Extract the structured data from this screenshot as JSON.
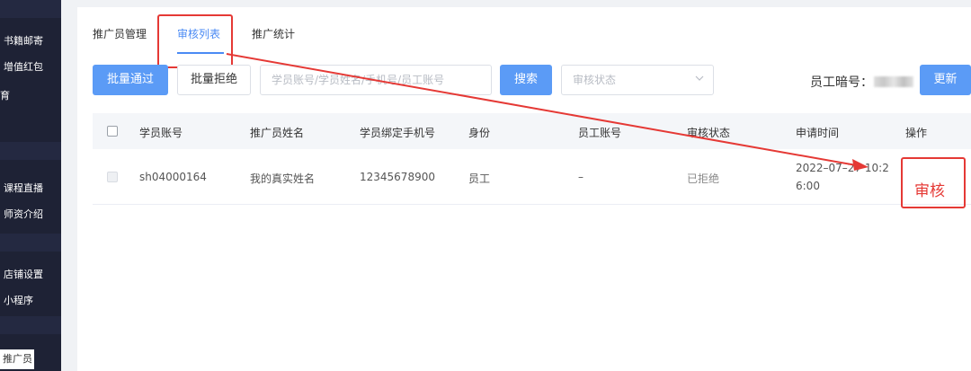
{
  "sidebar": {
    "items": [
      {
        "label": "书籍邮寄"
      },
      {
        "label": "增值红包"
      },
      {
        "label": "育"
      },
      {
        "label": "课程直播"
      },
      {
        "label": "师资介绍"
      },
      {
        "label": "店铺设置"
      },
      {
        "label": "小程序"
      }
    ],
    "active_label": "推广员"
  },
  "tabs": [
    {
      "label": "推广员管理"
    },
    {
      "label": "审核列表"
    },
    {
      "label": "推广统计"
    }
  ],
  "toolbar": {
    "approve_label": "批量通过",
    "reject_label": "批量拒绝",
    "search_placeholder": "学员账号/学员姓名/手机号/员工账号",
    "search_label": "搜索",
    "status_placeholder": "审核状态",
    "employee_code_label": "员工暗号：",
    "update_label": "更新"
  },
  "table": {
    "headers": [
      "学员账号",
      "推广员姓名",
      "学员绑定手机号",
      "身份",
      "员工账号",
      "审核状态",
      "申请时间",
      "操作"
    ],
    "rows": [
      {
        "student_account": "sh04000164",
        "promoter_name": "我的真实姓名",
        "phone": "12345678900",
        "identity": "员工",
        "employee_account": "–",
        "status": "已拒绝",
        "time_line1": "2022–07–27 10:2",
        "time_line2": "6:00",
        "action": "审核"
      }
    ]
  },
  "colors": {
    "accent": "#5b9bf6",
    "annotation": "#e53935",
    "sidebar": "#1e2235"
  }
}
